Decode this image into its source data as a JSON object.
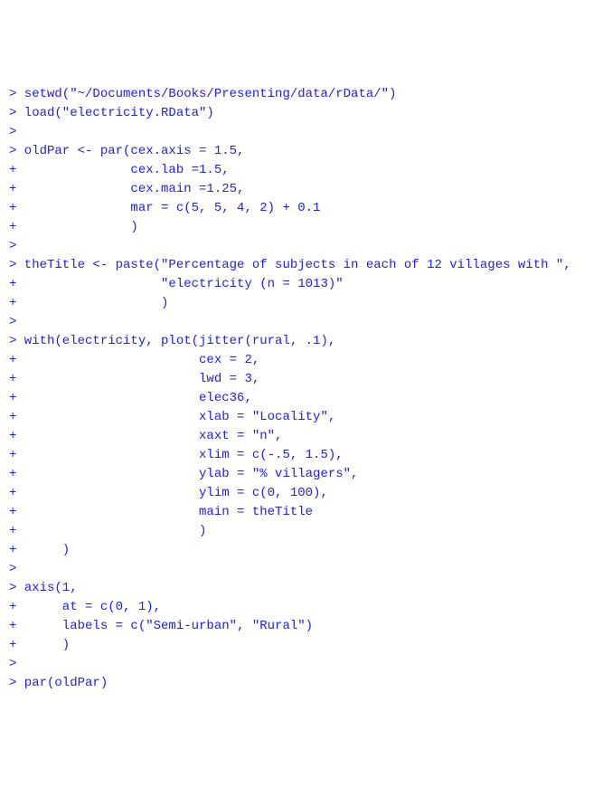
{
  "lines": [
    {
      "prompt": "> ",
      "code": "setwd(\"~/Documents/Books/Presenting/data/rData/\")"
    },
    {
      "prompt": "> ",
      "code": "load(\"electricity.RData\")"
    },
    {
      "prompt": "> ",
      "code": ""
    },
    {
      "prompt": "> ",
      "code": "oldPar <- par(cex.axis = 1.5,"
    },
    {
      "prompt": "+ ",
      "code": "              cex.lab =1.5,"
    },
    {
      "prompt": "+ ",
      "code": "              cex.main =1.25,"
    },
    {
      "prompt": "+ ",
      "code": "              mar = c(5, 5, 4, 2) + 0.1"
    },
    {
      "prompt": "+ ",
      "code": "              )"
    },
    {
      "prompt": "> ",
      "code": ""
    },
    {
      "prompt": "> ",
      "code": "theTitle <- paste(\"Percentage of subjects in each of 12 villages with \","
    },
    {
      "prompt": "+ ",
      "code": "                  \"electricity (n = 1013)\""
    },
    {
      "prompt": "+ ",
      "code": "                  )"
    },
    {
      "prompt": "> ",
      "code": ""
    },
    {
      "prompt": "> ",
      "code": "with(electricity, plot(jitter(rural, .1),"
    },
    {
      "prompt": "+ ",
      "code": "                       cex = 2,"
    },
    {
      "prompt": "+ ",
      "code": "                       lwd = 3,"
    },
    {
      "prompt": "+ ",
      "code": "                       elec36,"
    },
    {
      "prompt": "+ ",
      "code": "                       xlab = \"Locality\","
    },
    {
      "prompt": "+ ",
      "code": "                       xaxt = \"n\","
    },
    {
      "prompt": "+ ",
      "code": "                       xlim = c(-.5, 1.5),"
    },
    {
      "prompt": "+ ",
      "code": "                       ylab = \"% villagers\","
    },
    {
      "prompt": "+ ",
      "code": "                       ylim = c(0, 100),"
    },
    {
      "prompt": "+ ",
      "code": "                       main = theTitle"
    },
    {
      "prompt": "+ ",
      "code": "                       )"
    },
    {
      "prompt": "+ ",
      "code": "     )"
    },
    {
      "prompt": "> ",
      "code": ""
    },
    {
      "prompt": "> ",
      "code": "axis(1,"
    },
    {
      "prompt": "+ ",
      "code": "     at = c(0, 1),"
    },
    {
      "prompt": "+ ",
      "code": "     labels = c(\"Semi-urban\", \"Rural\")"
    },
    {
      "prompt": "+ ",
      "code": "     )"
    },
    {
      "prompt": "> ",
      "code": ""
    },
    {
      "prompt": "> ",
      "code": "par(oldPar)"
    }
  ]
}
